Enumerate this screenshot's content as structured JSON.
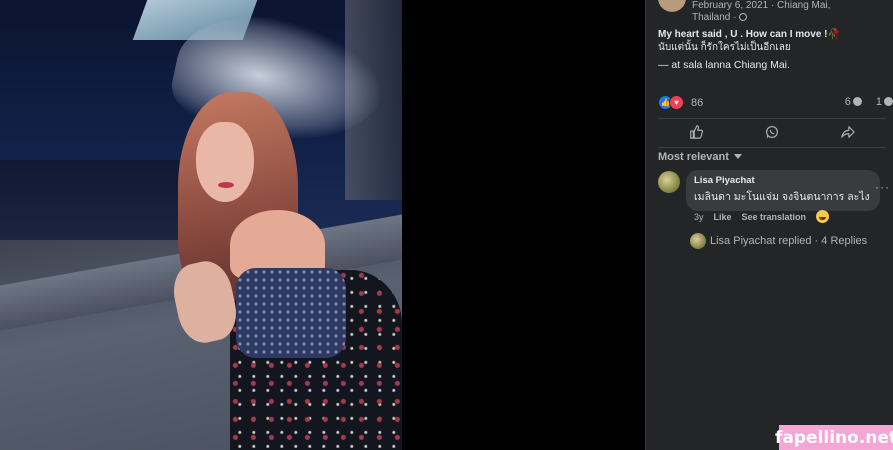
{
  "post": {
    "date": "February 6, 2021",
    "location_meta_1": "· Chiang Mai,",
    "location_meta_2": "Thailand ·",
    "privacy_icon": "globe-icon",
    "caption_line1": "My heart said , U . How can I move !🥀",
    "caption_line2": "นับแต่นั้น ก็รักใครไม่เป็นอีกเลย",
    "checkin_prefix": "— at",
    "checkin_place": "sala lanna Chiang Mai."
  },
  "reactions": {
    "like_icon": "👍",
    "love_icon": "♥",
    "count": "86",
    "comments_count": "6",
    "shares_count": "1"
  },
  "actions": {
    "like_icon": "like-icon",
    "whatsapp_icon": "whatsapp-icon",
    "share_icon": "share-icon"
  },
  "comments": {
    "sort_label": "Most relevant",
    "items": [
      {
        "author": "Lisa Piyachat",
        "text": "เมลินดา มะโนแจ่ม จงจินตนาการ ละไง",
        "time": "3y",
        "like_label": "Like",
        "translate_label": "See translation",
        "more_label": "···",
        "replies_label": "Lisa Piyachat replied · 4 Replies"
      }
    ]
  },
  "watermark": "fapellino.net",
  "colors": {
    "panel_bg": "#242526",
    "bubble_bg": "#3a3b3c",
    "like_blue": "#1877f2",
    "love_red": "#f33e58",
    "watermark_pink": "#f4a6d5"
  }
}
